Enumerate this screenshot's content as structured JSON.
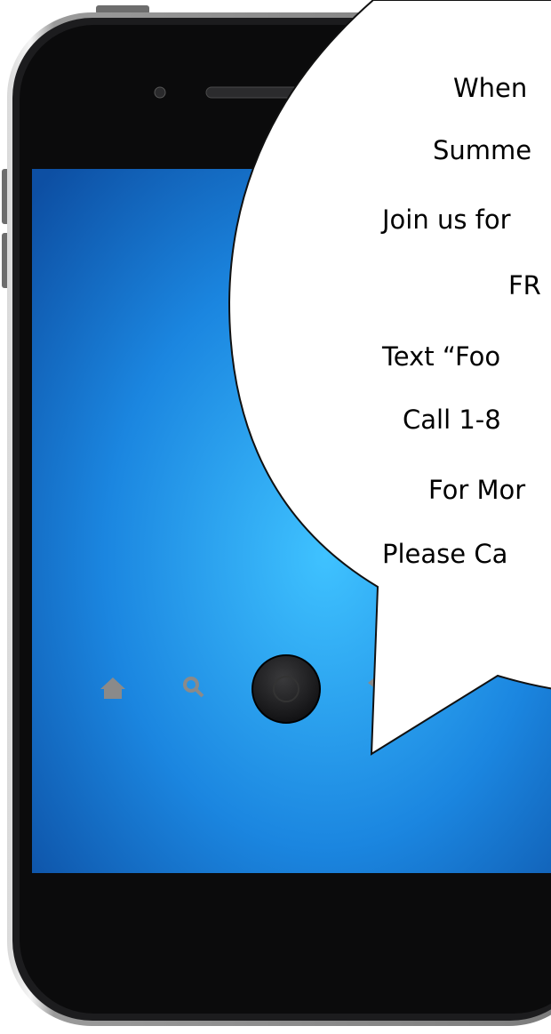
{
  "colors": {
    "frame": "#1c1c1e",
    "bezel": "#0b0b0c",
    "screen_light": "#3fc2ff",
    "screen_dark": "#0d4fa3",
    "bubble_fill": "#ffffff",
    "bubble_stroke": "#111111",
    "icon": "#8a8a8a"
  },
  "bubble": {
    "lines": [
      "When",
      "Summe",
      "Join us for",
      "FR",
      "Text “Foo",
      "Call 1-8",
      "For Mor",
      "Please Ca"
    ]
  },
  "phone": {
    "bottom_icons": [
      "home-icon",
      "search-icon",
      "home-button",
      "back-icon",
      "speaker-icon"
    ]
  }
}
